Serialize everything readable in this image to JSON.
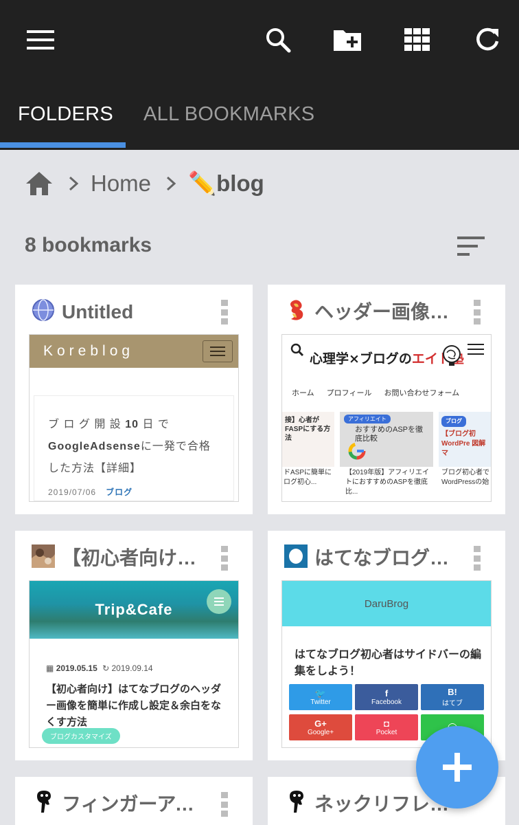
{
  "toolbar": {
    "icons": [
      "menu-icon",
      "search-icon",
      "add-folder-icon",
      "grid-view-icon",
      "refresh-icon"
    ]
  },
  "tabs": [
    {
      "label": "FOLDERS",
      "active": true
    },
    {
      "label": "ALL BOOKMARKS",
      "active": false
    }
  ],
  "breadcrumb": {
    "home": "Home",
    "current": "✏️blog"
  },
  "bookmark_count": "8 bookmarks",
  "cards": [
    {
      "title": "Untitled",
      "thumb": {
        "site": "Koreblog",
        "text_a": "ブ ロ グ 開 設 ",
        "text_b": "10",
        "text_c": " 日 で",
        "text_d": "GoogleAdsense",
        "text_e": "に一発で合格した方法【詳細】",
        "date": "2019/07/06",
        "category": "ブログ"
      }
    },
    {
      "title": "ヘッダー画像を…",
      "thumb": {
        "site_title_a": "心理学×ブログの",
        "site_title_b": "エイト塾",
        "nav": [
          "ホーム",
          "プロフィール",
          "お問い合わせフォーム"
        ],
        "post_label": "アフィリエイト",
        "post_text": "おすすめのASPを徹底比較",
        "post_label_right": "ブログ",
        "left_snippet": "接】心者がFASPにする方法",
        "right_snippet": "【ブログ初 WordPre 図解マ",
        "captions": [
          "ドASPに簡単にログ初心...",
          "【2019年版】アフィリエイトにおすすめのASPを徹底比...",
          "ブログ初心者でWordPressの始"
        ]
      }
    },
    {
      "title": "【初心者向け】…",
      "thumb": {
        "site": "Trip&Cafe",
        "published": "2019.05.15",
        "updated": "2019.09.14",
        "title": "【初心者向け】はてなブログのヘッダー画像を簡単に作成し設定＆余白をなくす方法",
        "tag": "ブログカスタマイズ"
      }
    },
    {
      "title": "はてなブログ初…",
      "thumb": {
        "site": "DaruBrog",
        "title": "はてなブログ初心者はサイドバーの編集をしよう！",
        "buttons": [
          {
            "glyph": "🐦",
            "label": "Twitter",
            "color": "#2f9be7"
          },
          {
            "glyph": "f",
            "label": "Facebook",
            "color": "#3b5c9c"
          },
          {
            "glyph": "B!",
            "label": "はてブ",
            "color": "#2f70b8"
          },
          {
            "glyph": "G+",
            "label": "Google+",
            "color": "#de4b3d"
          },
          {
            "glyph": "◘",
            "label": "Pocket",
            "color": "#ee4557"
          },
          {
            "glyph": "◯",
            "label": "",
            "color": "#2fc34a"
          }
        ]
      }
    },
    {
      "title": "フィンガーアイ…"
    },
    {
      "title": "ネックリフレッ…"
    }
  ],
  "colors": {
    "appbar": "#212121",
    "accent": "#4a90e2",
    "background": "#e3e4e8",
    "fab": "#4f9ef0"
  }
}
